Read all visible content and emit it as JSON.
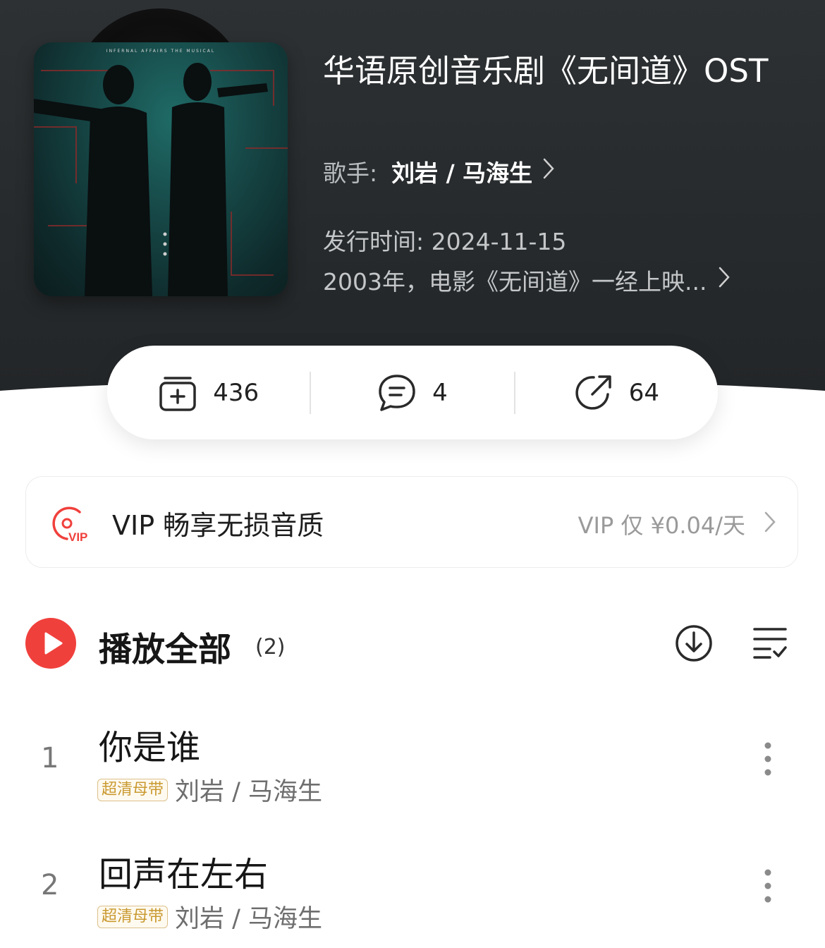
{
  "album": {
    "cover_caption": "INFERNAL AFFAIRS THE MUSICAL",
    "title": "华语原创音乐剧《无间道》OST",
    "artist_label": "歌手:",
    "artist": "刘岩 / 马海生",
    "release": "发行时间: 2024-11-15",
    "description": "2003年，电影《无间道》一经上映..."
  },
  "stats": {
    "collect_count": "436",
    "comment_count": "4",
    "share_count": "64"
  },
  "vip": {
    "text": "VIP 畅享无损音质",
    "price": "VIP 仅 ¥0.04/天",
    "badge": "VIP"
  },
  "playlist": {
    "play_all_label": "播放全部",
    "count": "(2)"
  },
  "songs": [
    {
      "index": "1",
      "title": "你是谁",
      "tag": "超清母带",
      "artist": "刘岩 / 马海生"
    },
    {
      "index": "2",
      "title": "回声在左右",
      "tag": "超清母带",
      "artist": "刘岩 / 马海生"
    }
  ],
  "colors": {
    "accent_red": "#f0403c",
    "tag_gold": "#c9992f",
    "header_bg": "#2a2e30"
  }
}
